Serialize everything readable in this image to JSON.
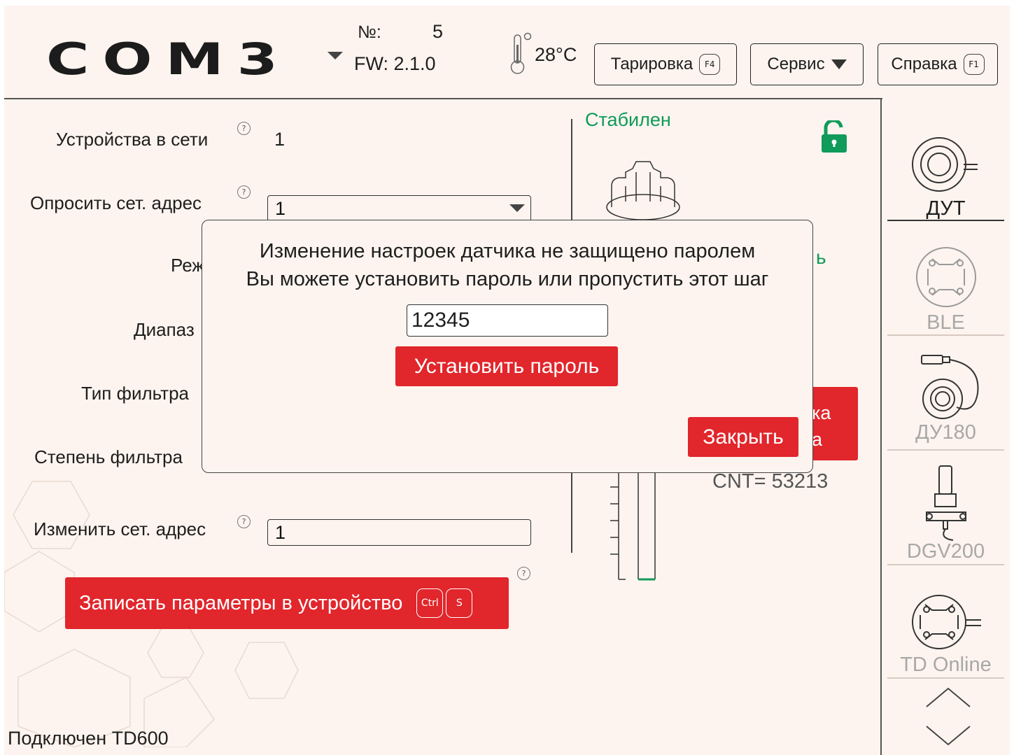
{
  "header": {
    "logo": "COM3",
    "device_number_label": "№:",
    "device_number": "5",
    "fw": "FW: 2.1.0",
    "temperature": "28°C",
    "buttons": {
      "tare": {
        "label": "Тарировка",
        "key": "F4"
      },
      "service": {
        "label": "Сервис"
      },
      "help": {
        "label": "Справка",
        "key": "F1"
      }
    }
  },
  "settings": {
    "devices_in_network_label": "Устройства в сети",
    "devices_in_network_value": "1",
    "poll_address_label": "Опросить сет. адрес",
    "poll_address_value": "1",
    "mode_label_partial": "Реж",
    "range_label_partial": "Диапаз",
    "filter_type_label_partial": "Тип фильтра",
    "filter_degree_label_partial": "Степень фильтра",
    "change_address_label": "Изменить сет. адрес",
    "change_address_value": "1",
    "help_glyph": "?",
    "write_button": {
      "label": "Записать параметры в устройство",
      "key1": "Ctrl",
      "key2": "S"
    }
  },
  "right_panel": {
    "status": "Стабилен",
    "partial_status": "ь",
    "tare_button_partial_1": "ка",
    "tare_button_partial_2": "а",
    "cnt": "CNT= 53213"
  },
  "status_bar": {
    "text": "Подключен TD600"
  },
  "sidebar": {
    "items": [
      {
        "label": "ДУТ",
        "active": true
      },
      {
        "label": "BLE",
        "active": false
      },
      {
        "label": "ДУ180",
        "active": false
      },
      {
        "label": "DGV200",
        "active": false
      },
      {
        "label": "TD Online",
        "active": false
      }
    ]
  },
  "modal": {
    "line1": "Изменение настроек датчика не защищено паролем",
    "line2": "Вы можете установить пароль или пропустить этот шаг",
    "password_value": "12345",
    "set_button": "Установить пароль",
    "close_button": "Закрыть"
  },
  "colors": {
    "accent_red": "#e1262c",
    "status_green": "#0f9b5a",
    "background": "#fdf4ef"
  }
}
